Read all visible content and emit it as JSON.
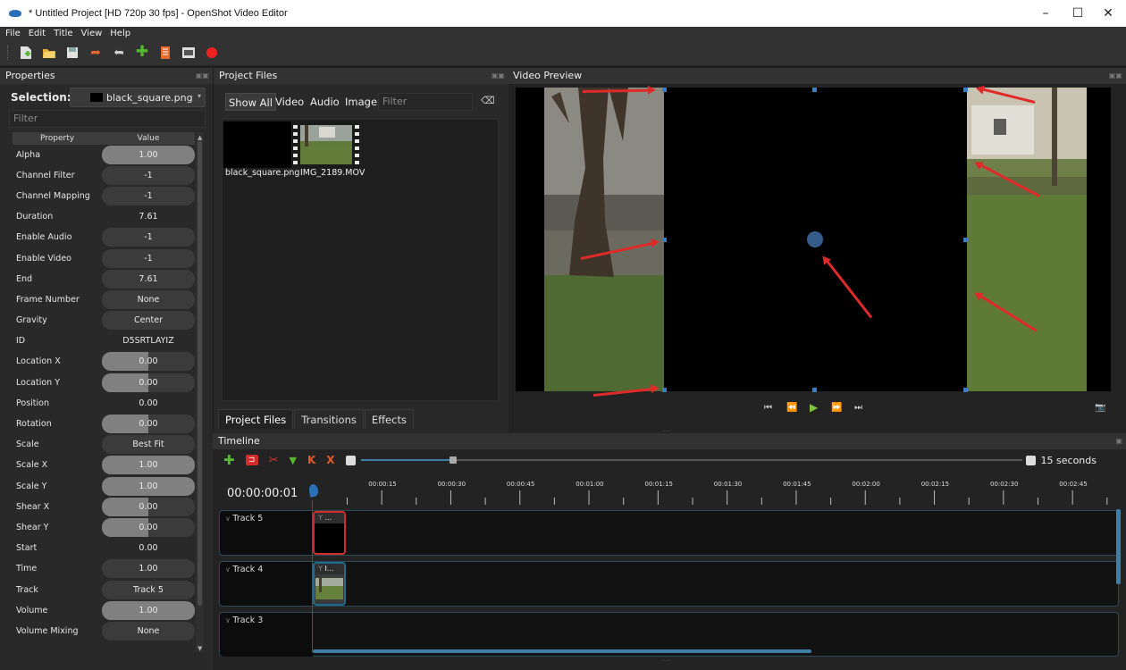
{
  "window": {
    "title": "* Untitled Project [HD 720p 30 fps] - OpenShot Video Editor",
    "minimize": "–",
    "maximize": "☐",
    "close": "✕"
  },
  "menu": [
    "File",
    "Edit",
    "Title",
    "View",
    "Help"
  ],
  "toolbar": {
    "icons": [
      "new-project-icon",
      "open-project-icon",
      "save-project-icon",
      "undo-icon",
      "redo-icon",
      "import-files-icon",
      "profile-icon",
      "export-icon",
      "record-icon"
    ]
  },
  "properties": {
    "title": "Properties",
    "selection_label": "Selection:",
    "selection_value": "black_square.png",
    "filter_placeholder": "Filter",
    "header_property": "Property",
    "header_value": "Value",
    "rows": [
      {
        "name": "Alpha",
        "value": "1.00",
        "style": "slider",
        "fill": 1.0
      },
      {
        "name": "Channel Filter",
        "value": "-1",
        "style": "dark"
      },
      {
        "name": "Channel Mapping",
        "value": "-1",
        "style": "dark"
      },
      {
        "name": "Duration",
        "value": "7.61",
        "style": "plain"
      },
      {
        "name": "Enable Audio",
        "value": "-1",
        "style": "dark"
      },
      {
        "name": "Enable Video",
        "value": "-1",
        "style": "dark"
      },
      {
        "name": "End",
        "value": "7.61",
        "style": "dark"
      },
      {
        "name": "Frame Number",
        "value": "None",
        "style": "dark"
      },
      {
        "name": "Gravity",
        "value": "Center",
        "style": "dark"
      },
      {
        "name": "ID",
        "value": "D5SRTLAYIZ",
        "style": "plain"
      },
      {
        "name": "Location X",
        "value": "0.00",
        "style": "slider",
        "fill": 0.5
      },
      {
        "name": "Location Y",
        "value": "0.00",
        "style": "slider",
        "fill": 0.5
      },
      {
        "name": "Position",
        "value": "0.00",
        "style": "plain"
      },
      {
        "name": "Rotation",
        "value": "0.00",
        "style": "slider",
        "fill": 0.5
      },
      {
        "name": "Scale",
        "value": "Best Fit",
        "style": "dark"
      },
      {
        "name": "Scale X",
        "value": "1.00",
        "style": "slider",
        "fill": 1.0
      },
      {
        "name": "Scale Y",
        "value": "1.00",
        "style": "slider",
        "fill": 1.0
      },
      {
        "name": "Shear X",
        "value": "0.00",
        "style": "slider",
        "fill": 0.5
      },
      {
        "name": "Shear Y",
        "value": "0.00",
        "style": "slider",
        "fill": 0.5
      },
      {
        "name": "Start",
        "value": "0.00",
        "style": "plain"
      },
      {
        "name": "Time",
        "value": "1.00",
        "style": "dark"
      },
      {
        "name": "Track",
        "value": "Track 5",
        "style": "dark"
      },
      {
        "name": "Volume",
        "value": "1.00",
        "style": "slider",
        "fill": 1.0
      },
      {
        "name": "Volume Mixing",
        "value": "None",
        "style": "dark"
      }
    ]
  },
  "project_files": {
    "title": "Project Files",
    "filters": [
      "Show All",
      "Video",
      "Audio",
      "Image"
    ],
    "filter_placeholder": "Filter",
    "files": [
      "black_square.png",
      "IMG_2189.MOV"
    ],
    "tabs": [
      "Project Files",
      "Transitions",
      "Effects"
    ]
  },
  "video_preview": {
    "title": "Video Preview"
  },
  "timeline": {
    "title": "Timeline",
    "timecode": "00:00:00:01",
    "zoom_label": "15 seconds",
    "zoom_level": 0.3,
    "ticks": [
      "00:00:15",
      "00:00:30",
      "00:00:45",
      "00:01:00",
      "00:01:15",
      "00:01:30",
      "00:01:45",
      "00:02:00",
      "00:02:15",
      "00:02:30",
      "00:02:45"
    ],
    "tracks": [
      {
        "name": "Track 5",
        "clip": "..."
      },
      {
        "name": "Track 4",
        "clip": "I..."
      },
      {
        "name": "Track 3",
        "clip": ""
      }
    ]
  }
}
